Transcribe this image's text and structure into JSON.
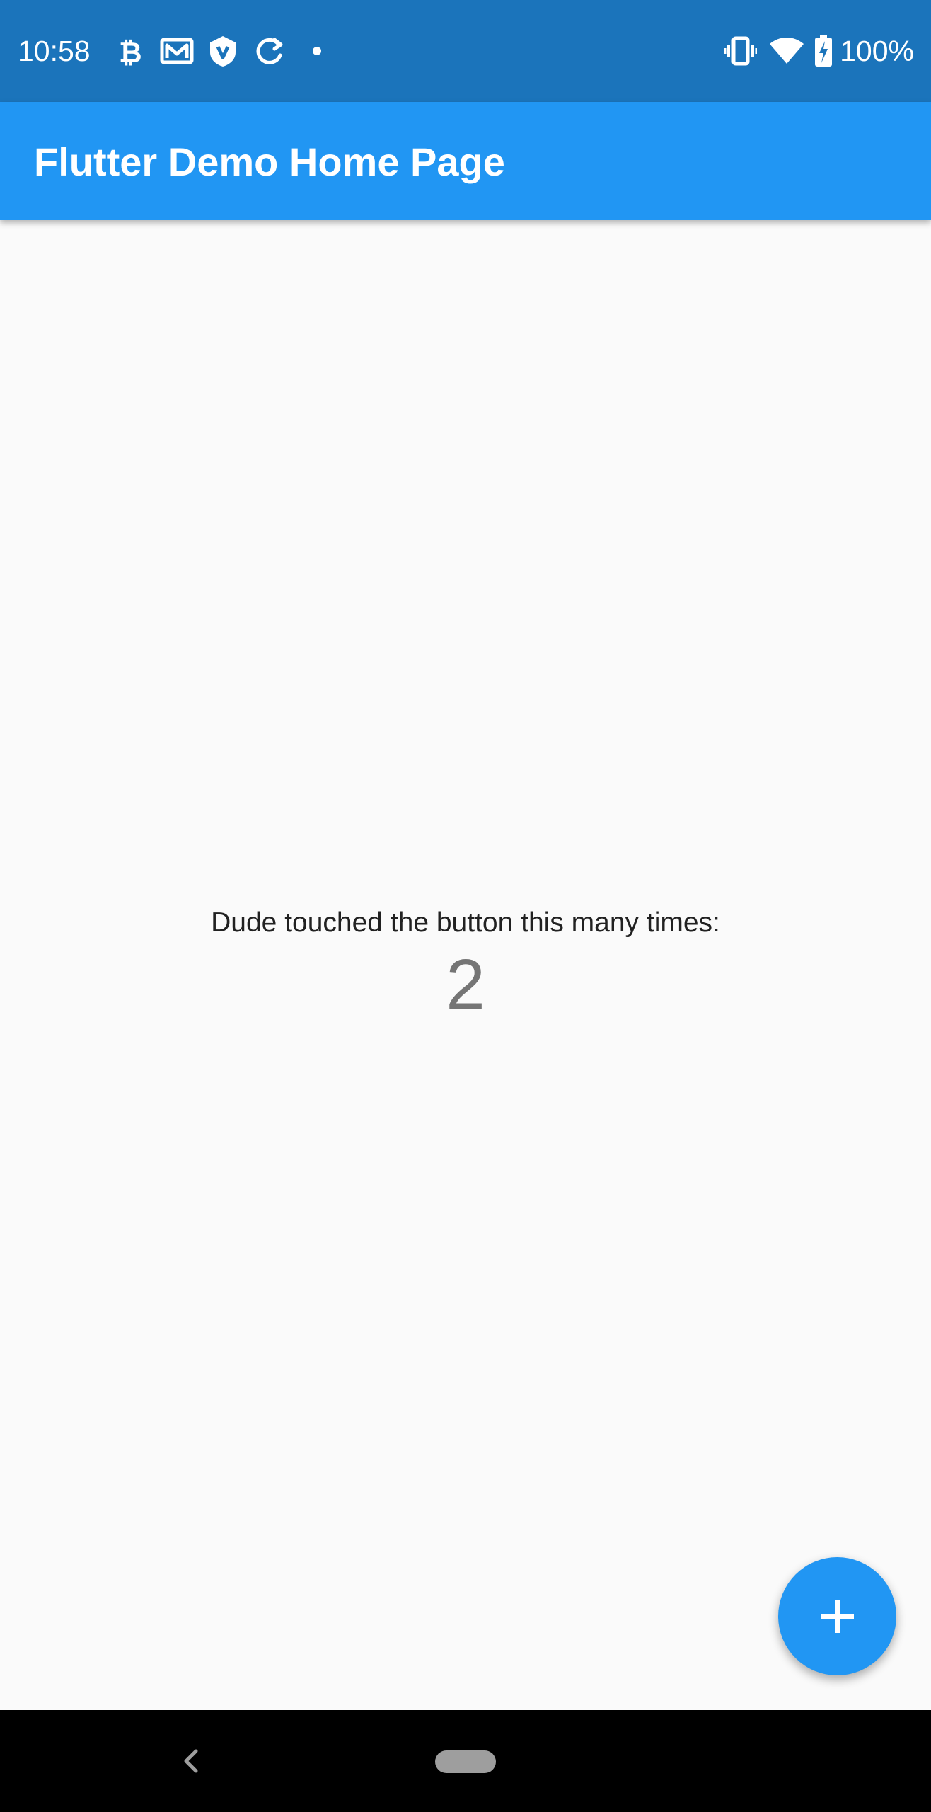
{
  "status_bar": {
    "time": "10:58",
    "battery": "100%",
    "icons": [
      "bitcoin-icon",
      "mail-icon",
      "shield-icon",
      "sync-icon",
      "dot-icon",
      "vibrate-icon",
      "wifi-icon",
      "battery-charging-icon"
    ]
  },
  "app_bar": {
    "title": "Flutter Demo Home Page"
  },
  "main": {
    "counter_label": "Dude touched the button this many times:",
    "counter_value": "2"
  },
  "fab": {
    "icon": "plus-icon"
  },
  "nav_bar": {
    "icons": [
      "back-icon",
      "home-pill-icon"
    ]
  },
  "colors": {
    "status_bar": "#1b74bb",
    "primary": "#2196f3",
    "background": "#fafafa",
    "nav_bar": "#000000"
  }
}
